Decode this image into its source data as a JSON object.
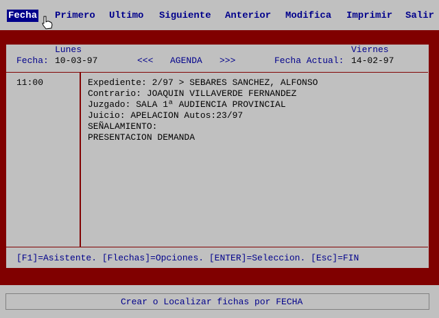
{
  "menu": {
    "items": [
      "Fecha",
      "Primero",
      "Ultimo",
      "Siguiente",
      "Anterior",
      "Modifica",
      "Imprimir",
      "Salir"
    ]
  },
  "agenda": {
    "left_day": "Lunes",
    "right_day": "Viernes",
    "fecha_label": "Fecha:",
    "fecha_value": "10-03-97",
    "prev_nav": "<<<",
    "title": "AGENDA",
    "next_nav": ">>>",
    "fecha_actual_label": "Fecha Actual:",
    "fecha_actual_value": "14-02-97"
  },
  "entry": {
    "time": "11:00",
    "lines": [
      "Expediente: 2/97 > SEBARES SANCHEZ, ALFONSO",
      "Contrario: JOAQUIN VILLAVERDE FERNANDEZ",
      "Juzgado: SALA 1ª AUDIENCIA PROVINCIAL",
      "Juicio: APELACION Autos:23/97",
      "SEÑALAMIENTO:",
      "PRESENTACION DEMANDA"
    ]
  },
  "help_line": "[F1]=Asistente. [Flechas]=Opciones. [ENTER]=Seleccion. [Esc]=FIN",
  "status_text": "Crear o Localizar fichas por FECHA",
  "colors": {
    "frame": "#800000",
    "panel": "#c0c0c0",
    "accent": "#00008b"
  }
}
